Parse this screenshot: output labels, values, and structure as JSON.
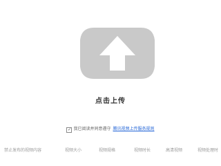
{
  "upload": {
    "icon": "upload-arrow-icon",
    "label": "点击上传"
  },
  "agreement": {
    "checked": true,
    "text": "我已阅读并同意遵守",
    "link_text": "腾讯视频上传服务规则"
  },
  "footer": {
    "items": [
      "禁止发布的视频内容",
      "视频大小",
      "视频规格",
      "视频时长",
      "高清视频",
      "视频处理时"
    ]
  },
  "colors": {
    "icon_fill": "#c9c9c9",
    "arrow": "#ffffff",
    "link": "#2a6ad8",
    "muted_text": "#9a9a9a"
  }
}
